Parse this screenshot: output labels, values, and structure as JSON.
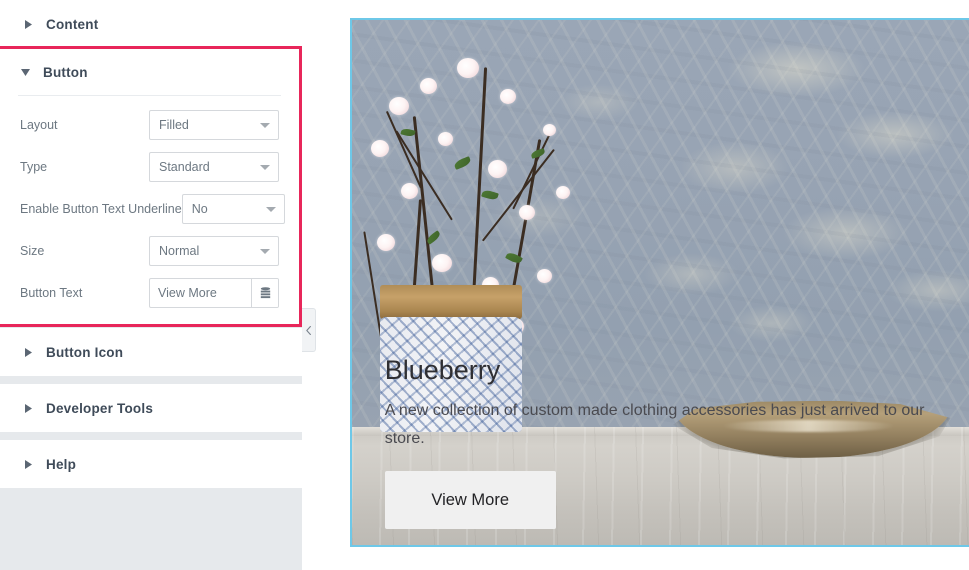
{
  "panel": {
    "sections": [
      {
        "id": "content",
        "label": "Content",
        "expanded": false
      },
      {
        "id": "button",
        "label": "Button",
        "expanded": true
      },
      {
        "id": "button-icon",
        "label": "Button Icon",
        "expanded": false
      },
      {
        "id": "dev-tools",
        "label": "Developer Tools",
        "expanded": false
      },
      {
        "id": "help",
        "label": "Help",
        "expanded": false
      }
    ],
    "button_section": {
      "title": "Button",
      "highlight_color": "#e8265a",
      "fields": [
        {
          "label": "Layout",
          "type": "select",
          "value": "Filled"
        },
        {
          "label": "Type",
          "type": "select",
          "value": "Standard"
        },
        {
          "label": "Enable Button Text Underline",
          "type": "select",
          "value": "No"
        },
        {
          "label": "Size",
          "type": "select",
          "value": "Normal"
        },
        {
          "label": "Button Text",
          "type": "text",
          "value": "View More",
          "placeholder": "Button Text",
          "dynamic_icon": "database-icon"
        }
      ]
    },
    "collapse_handle": {
      "icon": "chevron-left-icon"
    }
  },
  "preview": {
    "selection_color": "#6ec8e8",
    "heading": "Blueberry",
    "body": "A new collection of custom made clothing accessories has just arrived to our store.",
    "button_label": "View More",
    "image_description": "cherry-blossom-branches-in-blue-white-vase-with-brass-bowl-on-marble-counter"
  }
}
